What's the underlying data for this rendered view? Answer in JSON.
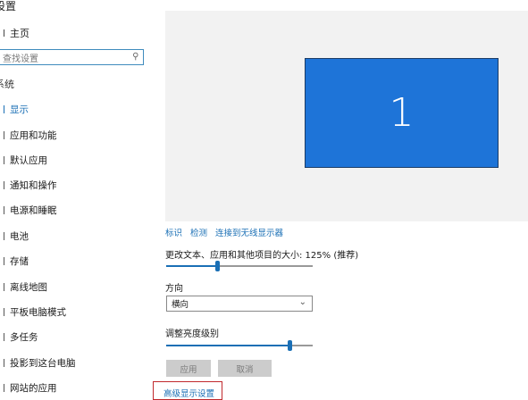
{
  "window": {
    "title": "设置"
  },
  "sidebar": {
    "home_label": "主页",
    "search_placeholder": "查找设置",
    "section_title": "系统",
    "items": [
      {
        "label": "显示",
        "active": true
      },
      {
        "label": "应用和功能"
      },
      {
        "label": "默认应用"
      },
      {
        "label": "通知和操作"
      },
      {
        "label": "电源和睡眠"
      },
      {
        "label": "电池"
      },
      {
        "label": "存储"
      },
      {
        "label": "离线地图"
      },
      {
        "label": "平板电脑模式"
      },
      {
        "label": "多任务"
      },
      {
        "label": "投影到这台电脑"
      },
      {
        "label": "网站的应用"
      }
    ]
  },
  "display": {
    "monitor_number": "1",
    "links": [
      "标识",
      "检测",
      "连接到无线显示器"
    ],
    "scale": {
      "label": "更改文本、应用和其他项目的大小: 125% (推荐)",
      "value_percent": 35
    },
    "orientation": {
      "label": "方向",
      "selected": "横向"
    },
    "brightness": {
      "label": "调整亮度级别",
      "value_percent": 84
    },
    "apply_label": "应用",
    "cancel_label": "取消",
    "advanced_link": "高级显示设置"
  },
  "colors": {
    "accent": "#1a6fb5",
    "monitor": "#1e74d8",
    "highlight_box": "#c0282c"
  }
}
